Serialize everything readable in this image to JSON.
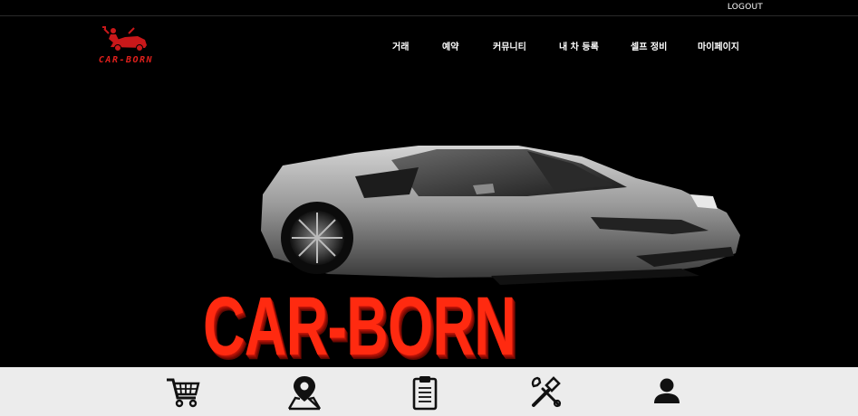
{
  "header": {
    "logout_label": "LOGOUT",
    "logo_text": "CAR-BORN",
    "nav": [
      "거래",
      "예약",
      "커뮤니티",
      "내 차 등록",
      "셀프 정비",
      "마이페이지"
    ]
  },
  "hero": {
    "title": "CAR-BORN"
  },
  "quick_menu": {
    "icons": [
      "cart-icon",
      "map-pin-icon",
      "clipboard-icon",
      "tools-icon",
      "user-icon"
    ]
  },
  "colors": {
    "brand_red": "#e0201c",
    "background": "#000000",
    "quickbar_bg": "#ececec"
  }
}
